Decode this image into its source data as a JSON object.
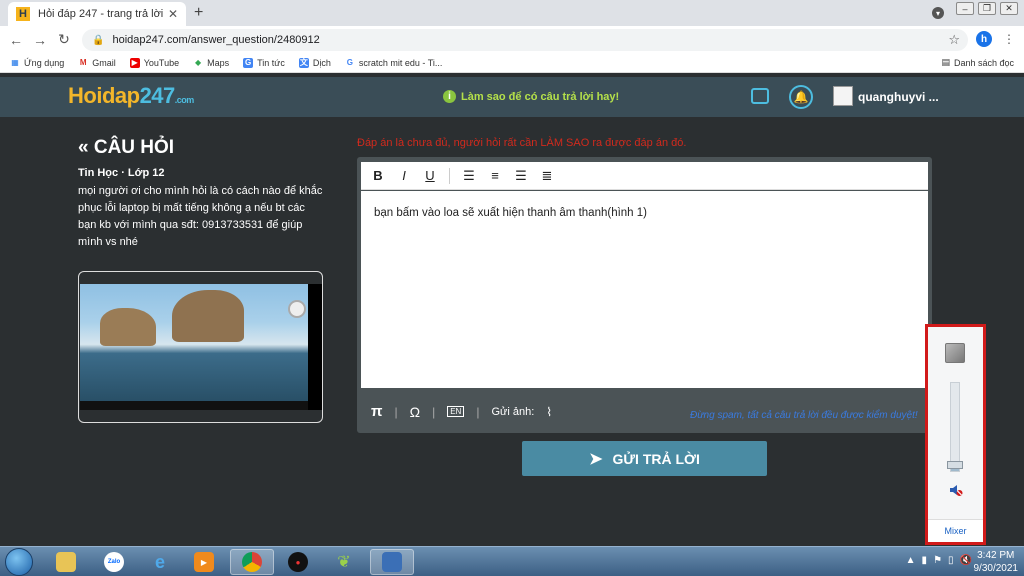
{
  "browser": {
    "tab_title": "Hỏi đáp 247 - trang trả lời",
    "tab_favicon": "H",
    "new_tab": "+",
    "url": "hoidap247.com/answer_question/2480912",
    "profile_initial": "h",
    "bookmarks": [
      "Ứng dụng",
      "Gmail",
      "YouTube",
      "Maps",
      "Tin tức",
      "Dịch",
      "scratch mit edu - Ti..."
    ],
    "reading_list": "Danh sách đọc"
  },
  "site": {
    "logo_main": "Hoidap",
    "logo_num": "247",
    "logo_tld": ".com",
    "tip": "Làm sao để có câu trả lời hay!",
    "username": "quanghuyvi ..."
  },
  "question": {
    "heading": "CÂU HỎI",
    "meta": "Tin Học · Lớp 12",
    "text": "mọi người ơi cho mình hỏi là có cách nào để khắc phục lỗi laptop bị mất tiếng không ạ nếu bt các bạn kb với mình qua sđt: 0913733531 để giúp mình vs nhé"
  },
  "answer": {
    "warning": "Đáp án là chưa đủ, người hỏi rất cần LÀM SAO ra được đáp án đó.",
    "body": "bạn bấm vào loa sẽ xuất hiện thanh âm thanh(hình 1)",
    "toolbar": [
      "B",
      "I",
      "U"
    ],
    "send_image": "Gửi ảnh:",
    "spam_note": "Đừng spam, tất cả câu trả lời đều được kiểm duyệt!",
    "submit": "GỬI TRẢ LỜI"
  },
  "volume_popup": {
    "mixer": "Mixer",
    "level_fraction": 0.1,
    "highlight_color": "#d11a1a"
  },
  "taskbar": {
    "time": "3:42 PM",
    "date": "9/30/2021",
    "apps": [
      "Zalo"
    ]
  }
}
